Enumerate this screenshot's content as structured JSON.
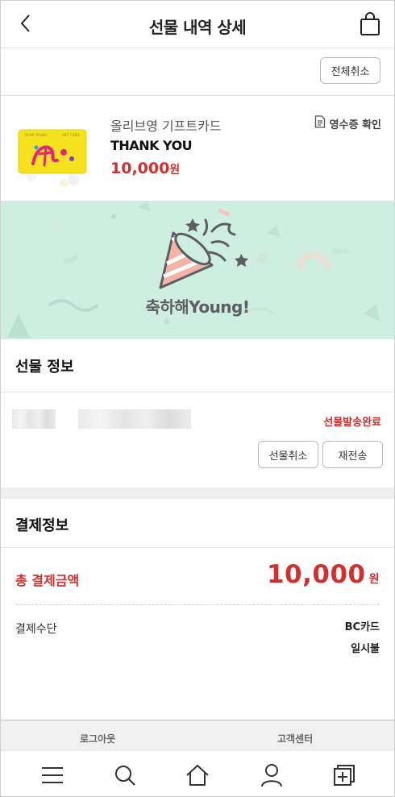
{
  "header": {
    "title": "선물 내역 상세"
  },
  "actions": {
    "cancel_all": "전체취소"
  },
  "product": {
    "name": "올리브영 기프트카드",
    "message": "THANK YOU",
    "price": "10,000",
    "price_unit": "원",
    "receipt_label": "영수증 확인"
  },
  "banner": {
    "text": "축하해Young!"
  },
  "gift_info": {
    "title": "선물 정보",
    "status": "선물발송완료",
    "cancel_button": "선물취소",
    "resend_button": "재전송"
  },
  "payment": {
    "title": "결제정보",
    "total_label": "총 결제금액",
    "total_value": "10,000",
    "total_unit": "원",
    "method_label": "결제수단",
    "method_card": "BC카드",
    "method_installment": "일시불"
  },
  "footer": {
    "logout": "로그아웃",
    "customer_center": "고객센터"
  },
  "colors": {
    "accent_red": "#d0302e",
    "banner_bg": "#cfeee2",
    "footer_line": "#b9cf6c"
  },
  "icons": [
    "back-arrow-icon",
    "shopping-bag-icon",
    "receipt-icon",
    "party-popper-icon",
    "menu-icon",
    "search-icon",
    "home-icon",
    "user-icon",
    "recent-items-icon"
  ]
}
